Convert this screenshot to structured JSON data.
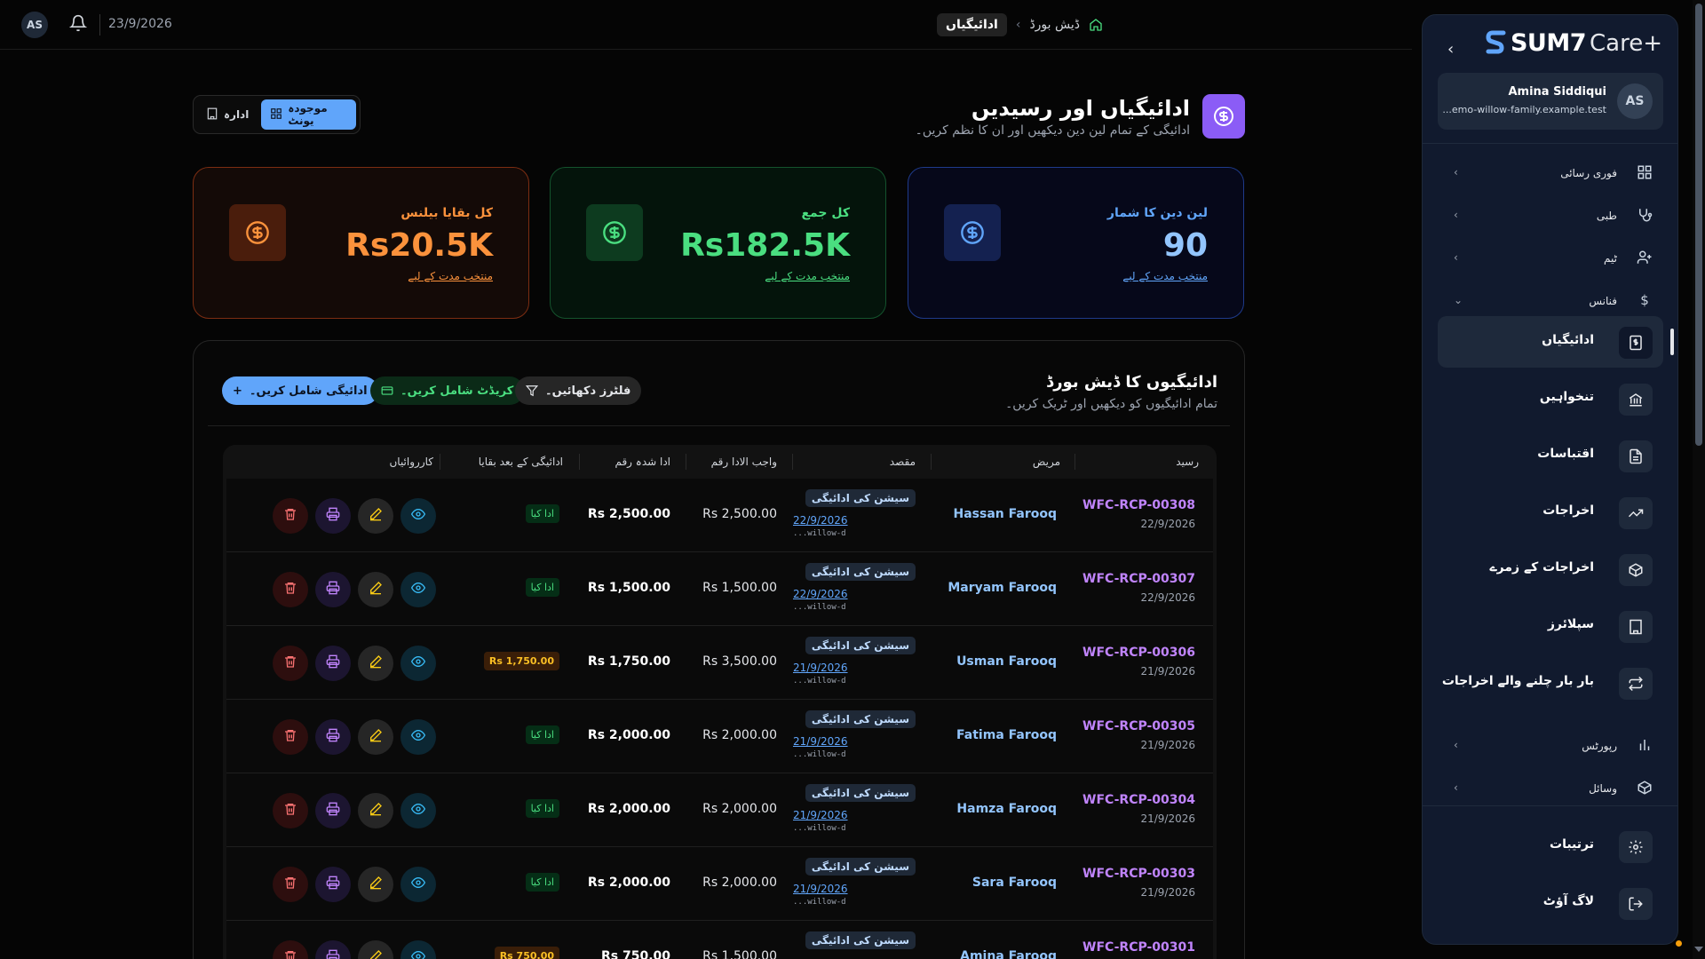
{
  "topbar": {
    "avatar": "AS",
    "date": "23/9/2026",
    "breadcrumb": {
      "current": "ادائیگیاں",
      "parent": "ڈیش بورڈ"
    }
  },
  "header": {
    "title": "ادائیگیاں اور رسیدیں",
    "subtitle": "ادائیگی کے تمام لین دین دیکھیں اور ان کا نظم کریں۔",
    "toggle": {
      "current_unit": "موجودہ یونٹ",
      "admin": "ادارہ"
    }
  },
  "stats": {
    "balance": {
      "label": "کل بقایا بیلنس",
      "value": "Rs20.5K",
      "note": "منتخب مدت کے لیے"
    },
    "total": {
      "label": "کل جمع",
      "value": "Rs182.5K",
      "note": "منتخب مدت کے لیے"
    },
    "count": {
      "label": "لین دین کا شمار",
      "value": "90",
      "note": "منتخب مدت کے لیے"
    }
  },
  "panel": {
    "title": "ادائیگیوں کا ڈیش بورڈ",
    "subtitle": "تمام ادائیگیوں کو دیکھیں اور ٹریک کریں۔",
    "add_label": "ادائیگی شامل کریں۔",
    "credit_label": "کریڈٹ شامل کریں۔",
    "filter_label": "فلٹرز دکھائیں۔"
  },
  "table": {
    "headers": {
      "receipt": "رسید",
      "patient": "مریض",
      "purpose": "مقصد",
      "due": "واجب الادا رقم",
      "paid": "ادا شدہ رقم",
      "balance": "ادائیگی کے بعد بقایا",
      "actions": "کارروائیاں"
    },
    "rows": [
      {
        "receipt": "WFC-RCP-00308",
        "date": "22/9/2026",
        "patient": "Hassan Farooq",
        "purpose": "سیشن کی ادائیگی",
        "purpose_date": "22/9/2026",
        "purpose_id": "...willow-d",
        "due": "Rs 2,500.00",
        "paid": "Rs 2,500.00",
        "status": "ادا کیا",
        "status_type": "ok"
      },
      {
        "receipt": "WFC-RCP-00307",
        "date": "22/9/2026",
        "patient": "Maryam Farooq",
        "purpose": "سیشن کی ادائیگی",
        "purpose_date": "22/9/2026",
        "purpose_id": "...willow-d",
        "due": "Rs 1,500.00",
        "paid": "Rs 1,500.00",
        "status": "ادا کیا",
        "status_type": "ok"
      },
      {
        "receipt": "WFC-RCP-00306",
        "date": "21/9/2026",
        "patient": "Usman Farooq",
        "purpose": "سیشن کی ادائیگی",
        "purpose_date": "21/9/2026",
        "purpose_id": "...willow-d",
        "due": "Rs 3,500.00",
        "paid": "Rs 1,750.00",
        "status": "Rs 1,750.00",
        "status_type": "due"
      },
      {
        "receipt": "WFC-RCP-00305",
        "date": "21/9/2026",
        "patient": "Fatima Farooq",
        "purpose": "سیشن کی ادائیگی",
        "purpose_date": "21/9/2026",
        "purpose_id": "...willow-d",
        "due": "Rs 2,000.00",
        "paid": "Rs 2,000.00",
        "status": "ادا کیا",
        "status_type": "ok"
      },
      {
        "receipt": "WFC-RCP-00304",
        "date": "21/9/2026",
        "patient": "Hamza Farooq",
        "purpose": "سیشن کی ادائیگی",
        "purpose_date": "21/9/2026",
        "purpose_id": "...willow-d",
        "due": "Rs 2,000.00",
        "paid": "Rs 2,000.00",
        "status": "ادا کیا",
        "status_type": "ok"
      },
      {
        "receipt": "WFC-RCP-00303",
        "date": "21/9/2026",
        "patient": "Sara Farooq",
        "purpose": "سیشن کی ادائیگی",
        "purpose_date": "21/9/2026",
        "purpose_id": "...willow-d",
        "due": "Rs 2,000.00",
        "paid": "Rs 2,000.00",
        "status": "ادا کیا",
        "status_type": "ok"
      },
      {
        "receipt": "WFC-RCP-00301",
        "date": "",
        "patient": "Amina Farooq",
        "purpose": "سیشن کی ادائیگی",
        "purpose_date": "",
        "purpose_id": "",
        "due": "Rs 1,500.00",
        "paid": "Rs 750.00",
        "status": "Rs 750.00",
        "status_type": "due"
      }
    ]
  },
  "sidebar": {
    "logo": "SUM7",
    "logo_suffix": "Care+",
    "user": {
      "initials": "AS",
      "name": "Amina Siddiqui",
      "email": "...emo-willow-family.example.test"
    },
    "groups": {
      "quick": "فوری رسائی",
      "medical": "طبی",
      "team": "ٹیم",
      "finance": "فنانس",
      "reports": "رپورٹس",
      "resources": "وسائل"
    },
    "finance_items": [
      "ادائیگیاں",
      "تنخواہیں",
      "اقتباسات",
      "اخراجات",
      "اخراجات کے زمرے",
      "سپلائرز",
      "بار بار چلنے والے اخراجات"
    ],
    "settings": "ترتیبات",
    "logout": "لاگ آؤٹ"
  }
}
